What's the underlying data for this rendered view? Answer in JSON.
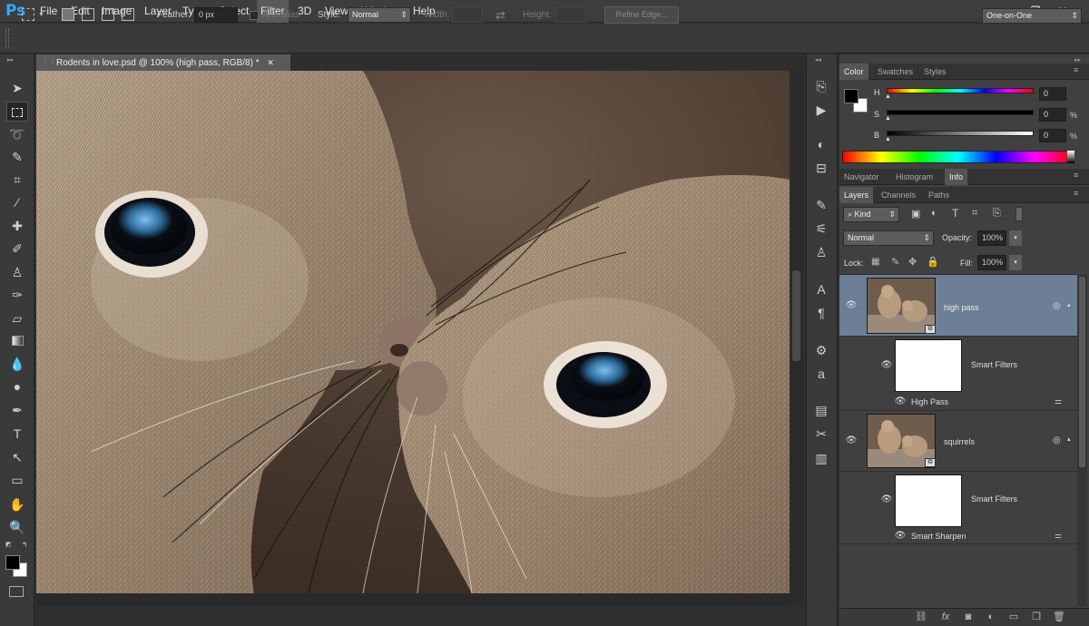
{
  "app": {
    "logo": "Ps"
  },
  "menu": [
    "File",
    "Edit",
    "Image",
    "Layer",
    "Type",
    "Select",
    "Filter",
    "3D",
    "View",
    "Window",
    "Help"
  ],
  "options": {
    "feather_label": "Feather:",
    "feather_value": "0 px",
    "antialias_label": "Anti-alias",
    "style_label": "Style:",
    "style_value": "Normal",
    "width_label": "Width:",
    "height_label": "Height:",
    "refine_edge": "Refine Edge...",
    "workspace": "One-on-One"
  },
  "document": {
    "tab_title": "Rodents in love.psd @ 100% (high pass, RGB/8) *"
  },
  "color_panel": {
    "tabs": [
      "Color",
      "Swatches",
      "Styles"
    ],
    "sliders": [
      {
        "label": "H",
        "value": "0",
        "unit": ""
      },
      {
        "label": "S",
        "value": "0",
        "unit": "%"
      },
      {
        "label": "B",
        "value": "0",
        "unit": "%"
      }
    ]
  },
  "info_panel": {
    "tabs": [
      "Navigator",
      "Histogram",
      "Info"
    ]
  },
  "layers_panel": {
    "tabs": [
      "Layers",
      "Channels",
      "Paths"
    ],
    "kind": "Kind",
    "blend_mode": "Normal",
    "opacity_label": "Opacity:",
    "opacity_value": "100%",
    "lock_label": "Lock:",
    "fill_label": "Fill:",
    "fill_value": "100%",
    "layers": [
      {
        "name": "high pass",
        "smart_filters": "Smart Filters",
        "filter": "High Pass"
      },
      {
        "name": "squirrels",
        "smart_filters": "Smart Filters",
        "filter": "Smart Sharpen"
      }
    ]
  },
  "colors": {
    "accent_ps": "#31a8ff",
    "selected_layer": "#6d7f97",
    "panel_bg": "#404040"
  }
}
